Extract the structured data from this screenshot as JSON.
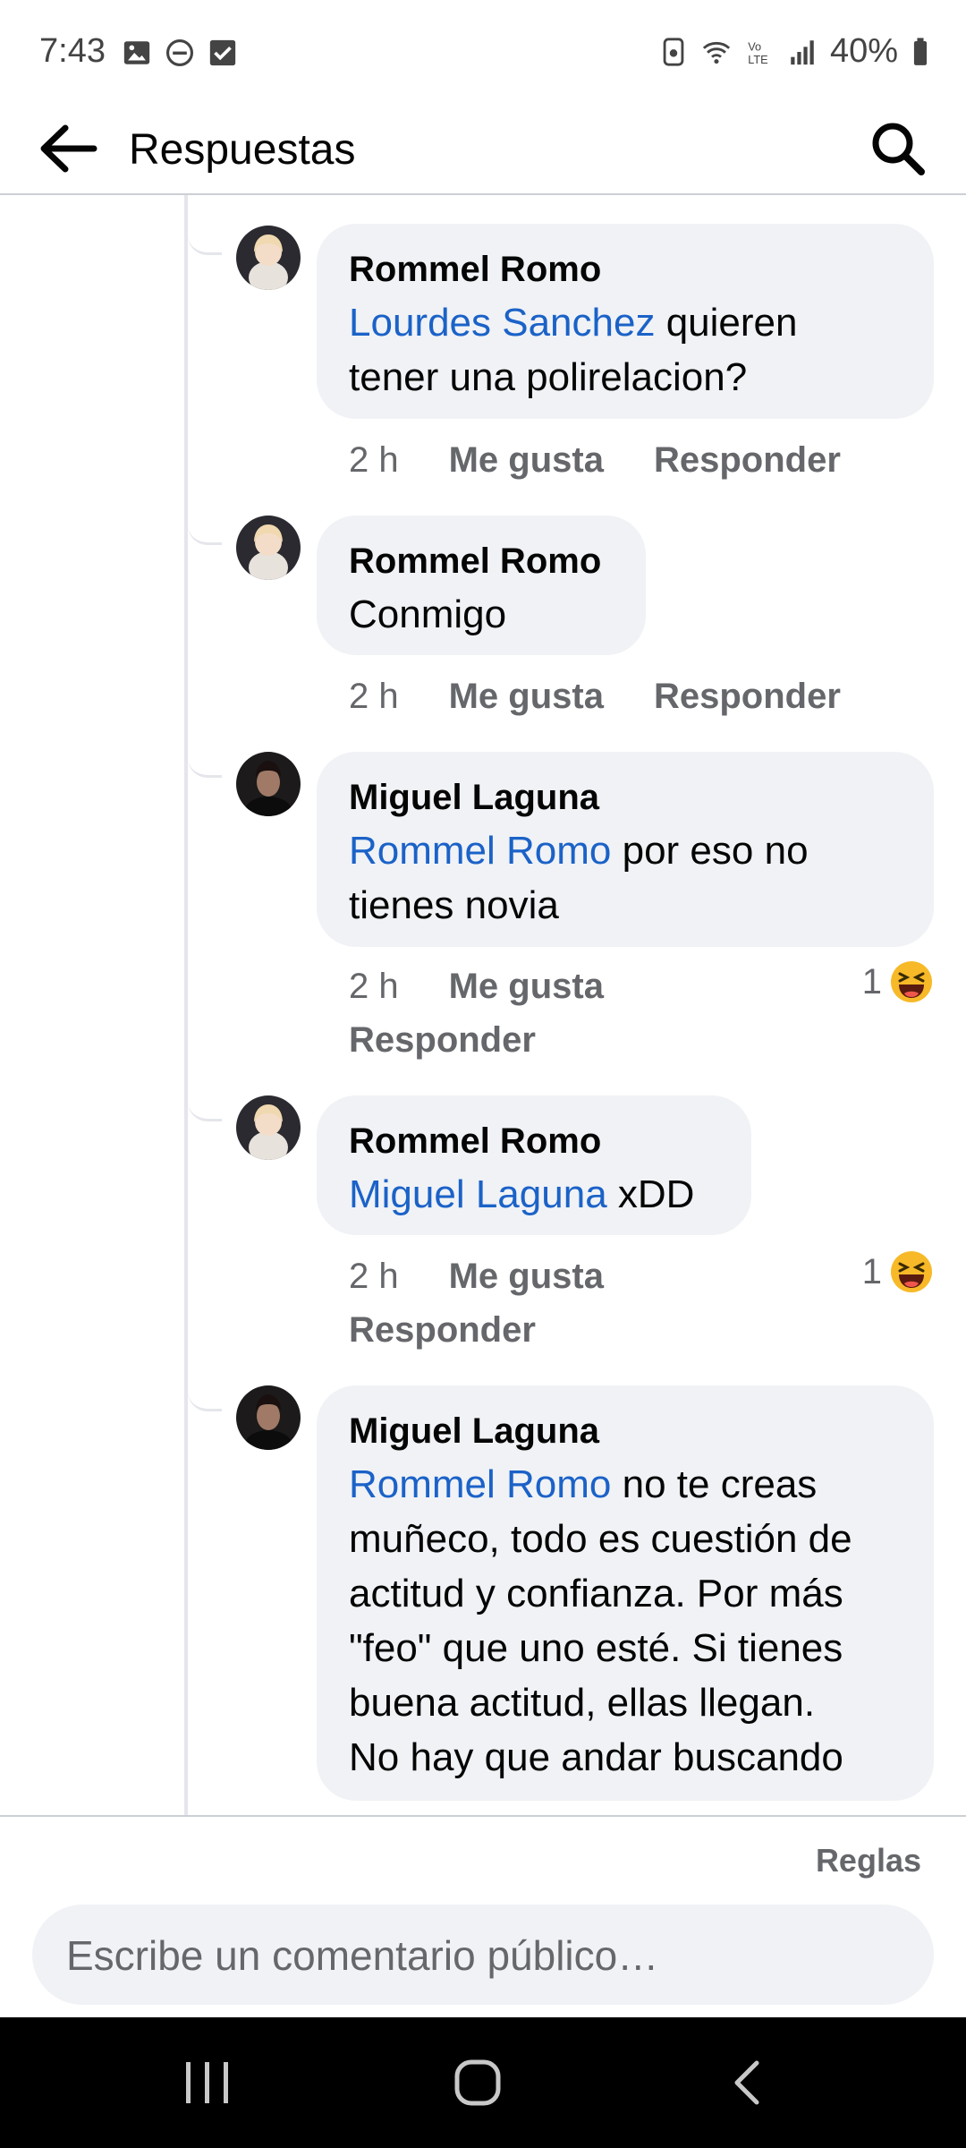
{
  "status_bar": {
    "time": "7:43",
    "battery": "40%"
  },
  "header": {
    "title": "Respuestas"
  },
  "comments": [
    {
      "author": "Rommel Romo",
      "mention": "Lourdes Sanchez",
      "text_line1_rest": " quieren",
      "text_line2": "tener una polirelacion?",
      "time": "2 h",
      "like": "Me gusta",
      "reply": "Responder"
    },
    {
      "author": "Rommel Romo",
      "text": "Conmigo",
      "time": "2 h",
      "like": "Me gusta",
      "reply": "Responder"
    },
    {
      "author": "Miguel Laguna",
      "mention": "Rommel Romo",
      "text_line1_rest": " por eso no",
      "text_line2": "tienes novia",
      "time": "2 h",
      "like": "Me gusta",
      "reply": "Responder",
      "reaction_count": "1"
    },
    {
      "author": "Rommel Romo",
      "mention": "Miguel Laguna",
      "text_line1_rest": " xDD",
      "time": "2 h",
      "like": "Me gusta",
      "reply": "Responder",
      "reaction_count": "1"
    },
    {
      "author": "Miguel Laguna",
      "mention": "Rommel Romo",
      "text_line1_rest": " no te creas",
      "lines": [
        "muñeco, todo es cuestión de",
        "actitud y confianza. Por más",
        "\"feo\" que uno esté. Si tienes",
        "buena actitud, ellas llegan.",
        "No hay que andar buscando"
      ]
    }
  ],
  "footer": {
    "rules": "Reglas",
    "composer_placeholder": "Escribe un comentario público…"
  },
  "colors": {
    "mention": "#1b62c8",
    "bubble": "#f0f2f5",
    "meta": "#65676b"
  },
  "icons": {
    "back": "arrow-left-icon",
    "search": "search-icon",
    "reaction": "haha-emoji-icon"
  }
}
